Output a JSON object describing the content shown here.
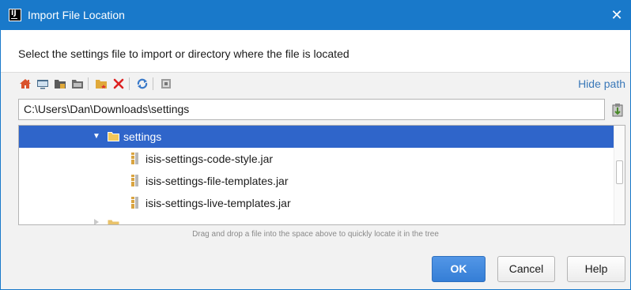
{
  "window": {
    "title": "Import File Location",
    "app_icon_text": "IJ",
    "close_glyph": "✕"
  },
  "description": "Select the settings file to import or directory where the file is located",
  "toolbar": {
    "buttons": [
      "home-icon",
      "desktop-icon",
      "project-folder-icon",
      "module-folder-icon",
      "new-folder-icon",
      "delete-icon",
      "refresh-icon",
      "toggle-hidden-icon"
    ],
    "hide_path_label": "Hide path"
  },
  "path": {
    "value": "C:\\Users\\Dan\\Downloads\\settings"
  },
  "tree": {
    "selected": {
      "label": "settings",
      "expander": "▼"
    },
    "children": [
      {
        "label": "isis-settings-code-style.jar"
      },
      {
        "label": "isis-settings-file-templates.jar"
      },
      {
        "label": "isis-settings-live-templates.jar"
      }
    ]
  },
  "drag_hint": "Drag and drop a file into the space above to quickly locate it in the tree",
  "buttons": {
    "ok": "OK",
    "cancel": "Cancel",
    "help": "Help"
  },
  "colors": {
    "titlebar": "#1979ca",
    "selection": "#2f65ca",
    "link": "#3a78b8",
    "ok_button": "#357ed6"
  }
}
